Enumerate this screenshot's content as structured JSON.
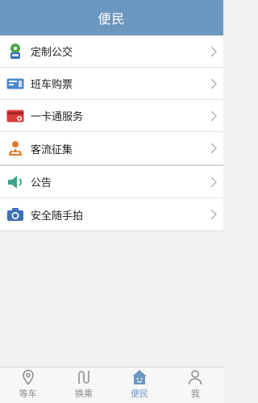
{
  "header": {
    "title": "便民"
  },
  "menu": {
    "group1": [
      {
        "label": "定制公交",
        "icon": "bus-pin-icon"
      },
      {
        "label": "班车购票",
        "icon": "ticket-icon"
      },
      {
        "label": "一卡通服务",
        "icon": "card-icon"
      },
      {
        "label": "客流征集",
        "icon": "people-icon"
      }
    ],
    "group2": [
      {
        "label": "公告",
        "icon": "speaker-icon"
      },
      {
        "label": "安全随手拍",
        "icon": "camera-icon"
      }
    ]
  },
  "tabs": [
    {
      "label": "等车",
      "icon": "location-pin-icon"
    },
    {
      "label": "换乘",
      "icon": "route-icon"
    },
    {
      "label": "便民",
      "icon": "home-face-icon",
      "active": true
    },
    {
      "label": "我",
      "icon": "user-icon"
    }
  ],
  "colors": {
    "header": "#6c97c1",
    "active_tab": "#6c97c1",
    "background": "#f2f1ef"
  }
}
